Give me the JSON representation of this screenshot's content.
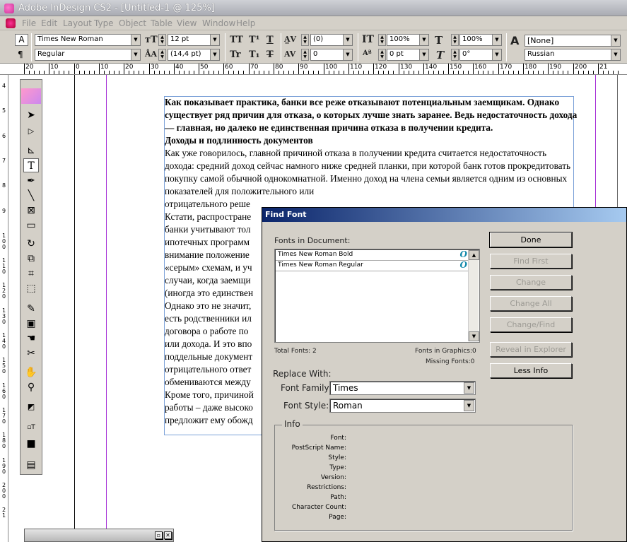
{
  "window": {
    "title": "Adobe InDesign CS2 - [Untitled-1 @ 125%]"
  },
  "menu": [
    "File",
    "Edit",
    "Layout",
    "Type",
    "Object",
    "Table",
    "View",
    "Window",
    "Help"
  ],
  "control": {
    "font_family": "Times New Roman",
    "font_style": "Regular",
    "font_size": "12 pt",
    "leading": "(14,4 pt)",
    "kerning": "(0)",
    "tracking": "0",
    "vscale": "100%",
    "hscale": "100%",
    "baseline": "0 pt",
    "skew": "0°",
    "char_style": "[None]",
    "language": "Russian",
    "char_icons": [
      "TT",
      "T¹",
      "T",
      "Tr",
      "T₁",
      "T"
    ]
  },
  "ruler_h": [
    "20",
    "10",
    "0",
    "10",
    "20",
    "30",
    "40",
    "50",
    "60",
    "70",
    "80",
    "90",
    "100",
    "110",
    "120",
    "130",
    "140",
    "150",
    "160",
    "170",
    "180",
    "190",
    "200",
    "21"
  ],
  "ruler_v": [
    "4",
    "5",
    "6",
    "7",
    "8",
    "9",
    "1 0 0",
    "1 1 0",
    "1 2 0",
    "1 3 0",
    "1 4 0",
    "1 5 0",
    "1 6 0",
    "1 7 0",
    "1 8 0",
    "1 9 0",
    "2 0 0",
    "2 1"
  ],
  "story": {
    "lead_bold": "Как показывает практика, банки все реже отказывают потенциальным заемщикам. Однако существует ряд причин для отказа, о которых лучше знать заранее. Ведь недостаточность дохода — главная, но далеко не единственная причина отказа в получении кредита.",
    "heading_bold": "Доходы и подлинность документов",
    "body_1": "Как уже говорилось, главной причиной отказа в получении кредита считается недостаточность дохода: средний доход сейчас намного ниже средней планки, при которой банк готов прокредитовать покупку самой обычной однокомнатной. Именно доход на члена семьи является одним из основных показателей для положительного или",
    "lines_left": [
      "отрицательного реше",
      "Кстати, распростране",
      "банки учитывают тол",
      "ипотечных программ",
      "внимание положение",
      "«серым» схемам, и уч",
      "случаи, когда заемщи",
      "(иногда это единствен",
      "Однако это не значит,",
      "есть родственники ил",
      "договора о работе по",
      "или дохода. И это впо",
      "поддельные документ",
      "отрицательного ответ",
      "обмениваются между",
      "Кроме того, причиной",
      "работы – даже высоко",
      "предложит ему обожд"
    ]
  },
  "dialog": {
    "title": "Find Font",
    "fonts_label": "Fonts in Document:",
    "fonts": [
      {
        "name": "Times New Roman Bold",
        "type_icon": "O"
      },
      {
        "name": "Times New Roman Regular",
        "type_icon": "O"
      }
    ],
    "total_fonts": "Total Fonts: 2",
    "fonts_in_graphics": "Fonts in Graphics:0",
    "missing_fonts": "Missing Fonts:0",
    "replace_with": "Replace With:",
    "font_family_label": "Font Family:",
    "font_family_value": "Times",
    "font_style_label": "Font Style:",
    "font_style_value": "Roman",
    "buttons": {
      "done": "Done",
      "find_first": "Find First",
      "change": "Change",
      "change_all": "Change All",
      "change_find": "Change/Find",
      "reveal": "Reveal in Explorer",
      "less_info": "Less Info"
    },
    "info_label": "Info",
    "info_keys": [
      "Font:",
      "PostScript Name:",
      "Style:",
      "Type:",
      "Version:",
      "Restrictions:",
      "Path:",
      "Character Count:",
      "Page:"
    ]
  }
}
